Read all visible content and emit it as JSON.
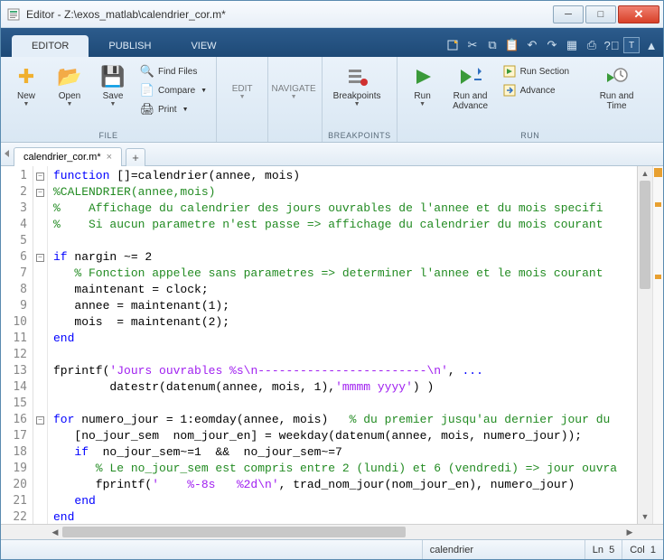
{
  "window": {
    "title": "Editor - Z:\\exos_matlab\\calendrier_cor.m*"
  },
  "ribbon": {
    "tabs": [
      "EDITOR",
      "PUBLISH",
      "VIEW"
    ],
    "active_tab": 0,
    "groups": {
      "file": {
        "label": "FILE",
        "new": "New",
        "open": "Open",
        "save": "Save",
        "find_files": "Find Files",
        "compare": "Compare",
        "print": "Print"
      },
      "edit": {
        "label": "EDIT"
      },
      "navigate": {
        "label": "NAVIGATE"
      },
      "breakpoints": {
        "label": "BREAKPOINTS",
        "breakpoints": "Breakpoints"
      },
      "run": {
        "label": "RUN",
        "run": "Run",
        "run_and_advance": "Run and\nAdvance",
        "run_section": "Run Section",
        "advance": "Advance",
        "run_and_time": "Run and\nTime"
      }
    }
  },
  "file_tab": {
    "name": "calendrier_cor.m*",
    "add": "+"
  },
  "code": {
    "lines": [
      {
        "n": 1,
        "fold": "-",
        "kw": "function",
        "t1": " []=calendrier(annee, mois)"
      },
      {
        "n": 2,
        "fold": "-",
        "cm": "%CALENDRIER(annee,mois)"
      },
      {
        "n": 3,
        "cm": "%    Affichage du calendrier des jours ouvrables de l'annee et du mois specifi"
      },
      {
        "n": 4,
        "cm": "%    Si aucun parametre n'est passe => affichage du calendrier du mois courant"
      },
      {
        "n": 5
      },
      {
        "n": 6,
        "fold": "-",
        "kw": "if",
        "t1": " nargin ~= 2"
      },
      {
        "n": 7,
        "cm": "   % Fonction appelee sans parametres => determiner l'annee et le mois courant"
      },
      {
        "n": 8,
        "t1": "   maintenant = clock;"
      },
      {
        "n": 9,
        "t1": "   annee = maintenant(1);"
      },
      {
        "n": 10,
        "t1": "   mois  = maintenant(2);"
      },
      {
        "n": 11,
        "kw": "end"
      },
      {
        "n": 12
      },
      {
        "n": 13,
        "t0": "fprintf(",
        "s1": "'Jours ouvrables %s\\n------------------------\\n'",
        "t1": ", ",
        "kw2": "..."
      },
      {
        "n": 14,
        "t0": "        datestr(datenum(annee, mois, 1),",
        "s1": "'mmmm yyyy'",
        "t1": ") )"
      },
      {
        "n": 15
      },
      {
        "n": 16,
        "fold": "-",
        "kw": "for",
        "t1": " numero_jour = 1:eomday(annee, mois)   ",
        "cm2": "% du premier jusqu'au dernier jour du"
      },
      {
        "n": 17,
        "t1": "   [no_jour_sem  nom_jour_en] = weekday(datenum(annee, mois, numero_jour));"
      },
      {
        "n": 18,
        "kw": "   if",
        "t1": "  no_jour_sem~=1  &&  no_jour_sem~=7"
      },
      {
        "n": 19,
        "cm": "      % Le no_jour_sem est compris entre 2 (lundi) et 6 (vendredi) => jour ouvra"
      },
      {
        "n": 20,
        "t0": "      fprintf(",
        "s1": "'    %-8s   %2d\\n'",
        "t1": ", trad_nom_jour(nom_jour_en), numero_jour)"
      },
      {
        "n": 21,
        "kw": "   end"
      },
      {
        "n": 22,
        "fold": " ",
        "kw": "end"
      }
    ]
  },
  "status": {
    "func": "calendrier",
    "ln_label": "Ln",
    "ln": "5",
    "col_label": "Col",
    "col": "1"
  }
}
